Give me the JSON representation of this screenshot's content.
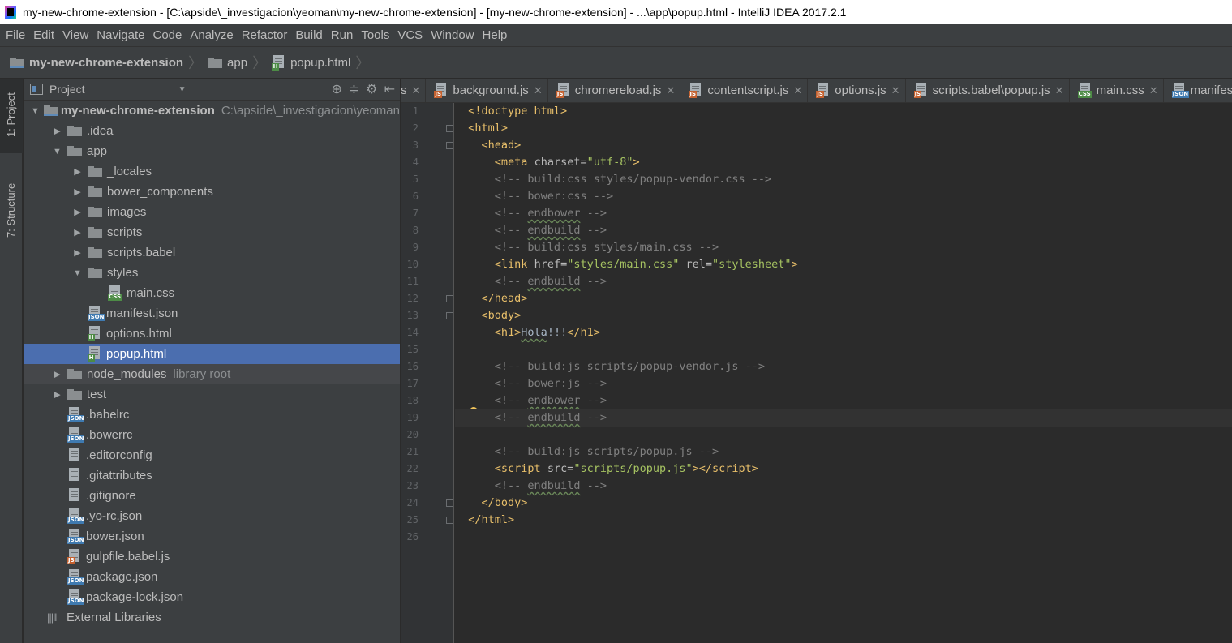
{
  "window": {
    "title": "my-new-chrome-extension - [C:\\apside\\_investigacion\\yeoman\\my-new-chrome-extension] - [my-new-chrome-extension] - ...\\app\\popup.html - IntelliJ IDEA 2017.2.1"
  },
  "menu": [
    "File",
    "Edit",
    "View",
    "Navigate",
    "Code",
    "Analyze",
    "Refactor",
    "Build",
    "Run",
    "Tools",
    "VCS",
    "Window",
    "Help"
  ],
  "breadcrumb": {
    "project": "my-new-chrome-extension",
    "folder": "app",
    "file": "popup.html"
  },
  "tool_stripe": {
    "project": "1: Project",
    "structure": "7: Structure"
  },
  "project_panel": {
    "title": "Project",
    "root_name": "my-new-chrome-extension",
    "root_path": "C:\\apside\\_investigacion\\yeoman",
    "items": [
      {
        "label": "my-new-chrome-extension",
        "icon": "module-folder-icon"
      },
      {
        "label": ".idea",
        "icon": "folder-icon"
      },
      {
        "label": "app",
        "icon": "folder-icon"
      },
      {
        "label": "_locales",
        "icon": "folder-icon"
      },
      {
        "label": "bower_components",
        "icon": "folder-icon"
      },
      {
        "label": "images",
        "icon": "folder-icon"
      },
      {
        "label": "scripts",
        "icon": "folder-icon"
      },
      {
        "label": "scripts.babel",
        "icon": "folder-icon"
      },
      {
        "label": "styles",
        "icon": "folder-icon"
      },
      {
        "label": "main.css",
        "icon": "css-file-icon"
      },
      {
        "label": "manifest.json",
        "icon": "json-file-icon"
      },
      {
        "label": "options.html",
        "icon": "html-file-icon"
      },
      {
        "label": "popup.html",
        "icon": "html-file-icon"
      },
      {
        "label": "node_modules",
        "icon": "folder-icon"
      },
      {
        "label": "test",
        "icon": "folder-icon"
      },
      {
        "label": ".babelrc",
        "icon": "json-file-icon"
      },
      {
        "label": ".bowerrc",
        "icon": "json-file-icon"
      },
      {
        "label": ".editorconfig",
        "icon": "text-file-icon"
      },
      {
        "label": ".gitattributes",
        "icon": "text-file-icon"
      },
      {
        "label": ".gitignore",
        "icon": "text-file-icon"
      },
      {
        "label": ".yo-rc.json",
        "icon": "json-file-icon"
      },
      {
        "label": "bower.json",
        "icon": "json-file-icon"
      },
      {
        "label": "gulpfile.babel.js",
        "icon": "js-file-icon"
      },
      {
        "label": "package.json",
        "icon": "json-file-icon"
      },
      {
        "label": "package-lock.json",
        "icon": "json-file-icon"
      },
      {
        "label": "External Libraries",
        "icon": "library-icon"
      }
    ],
    "node_modules_suffix": "library root"
  },
  "tabs": [
    {
      "label": "s",
      "type": "js"
    },
    {
      "label": "background.js",
      "type": "js"
    },
    {
      "label": "chromereload.js",
      "type": "js"
    },
    {
      "label": "contentscript.js",
      "type": "js"
    },
    {
      "label": "options.js",
      "type": "js"
    },
    {
      "label": "scripts.babel\\popup.js",
      "type": "js"
    },
    {
      "label": "main.css",
      "type": "css"
    },
    {
      "label": "manifes",
      "type": "json"
    }
  ],
  "editor": {
    "line_numbers": [
      "1",
      "2",
      "3",
      "4",
      "5",
      "6",
      "7",
      "8",
      "9",
      "10",
      "11",
      "12",
      "13",
      "14",
      "15",
      "16",
      "17",
      "18",
      "19",
      "20",
      "21",
      "22",
      "23",
      "24",
      "25",
      "26"
    ],
    "current_line": 19
  },
  "colors": {
    "selection": "#4b6eaf",
    "tag": "#e8bf6a",
    "string": "#a5c261",
    "comment": "#808080",
    "background": "#2b2b2b"
  }
}
